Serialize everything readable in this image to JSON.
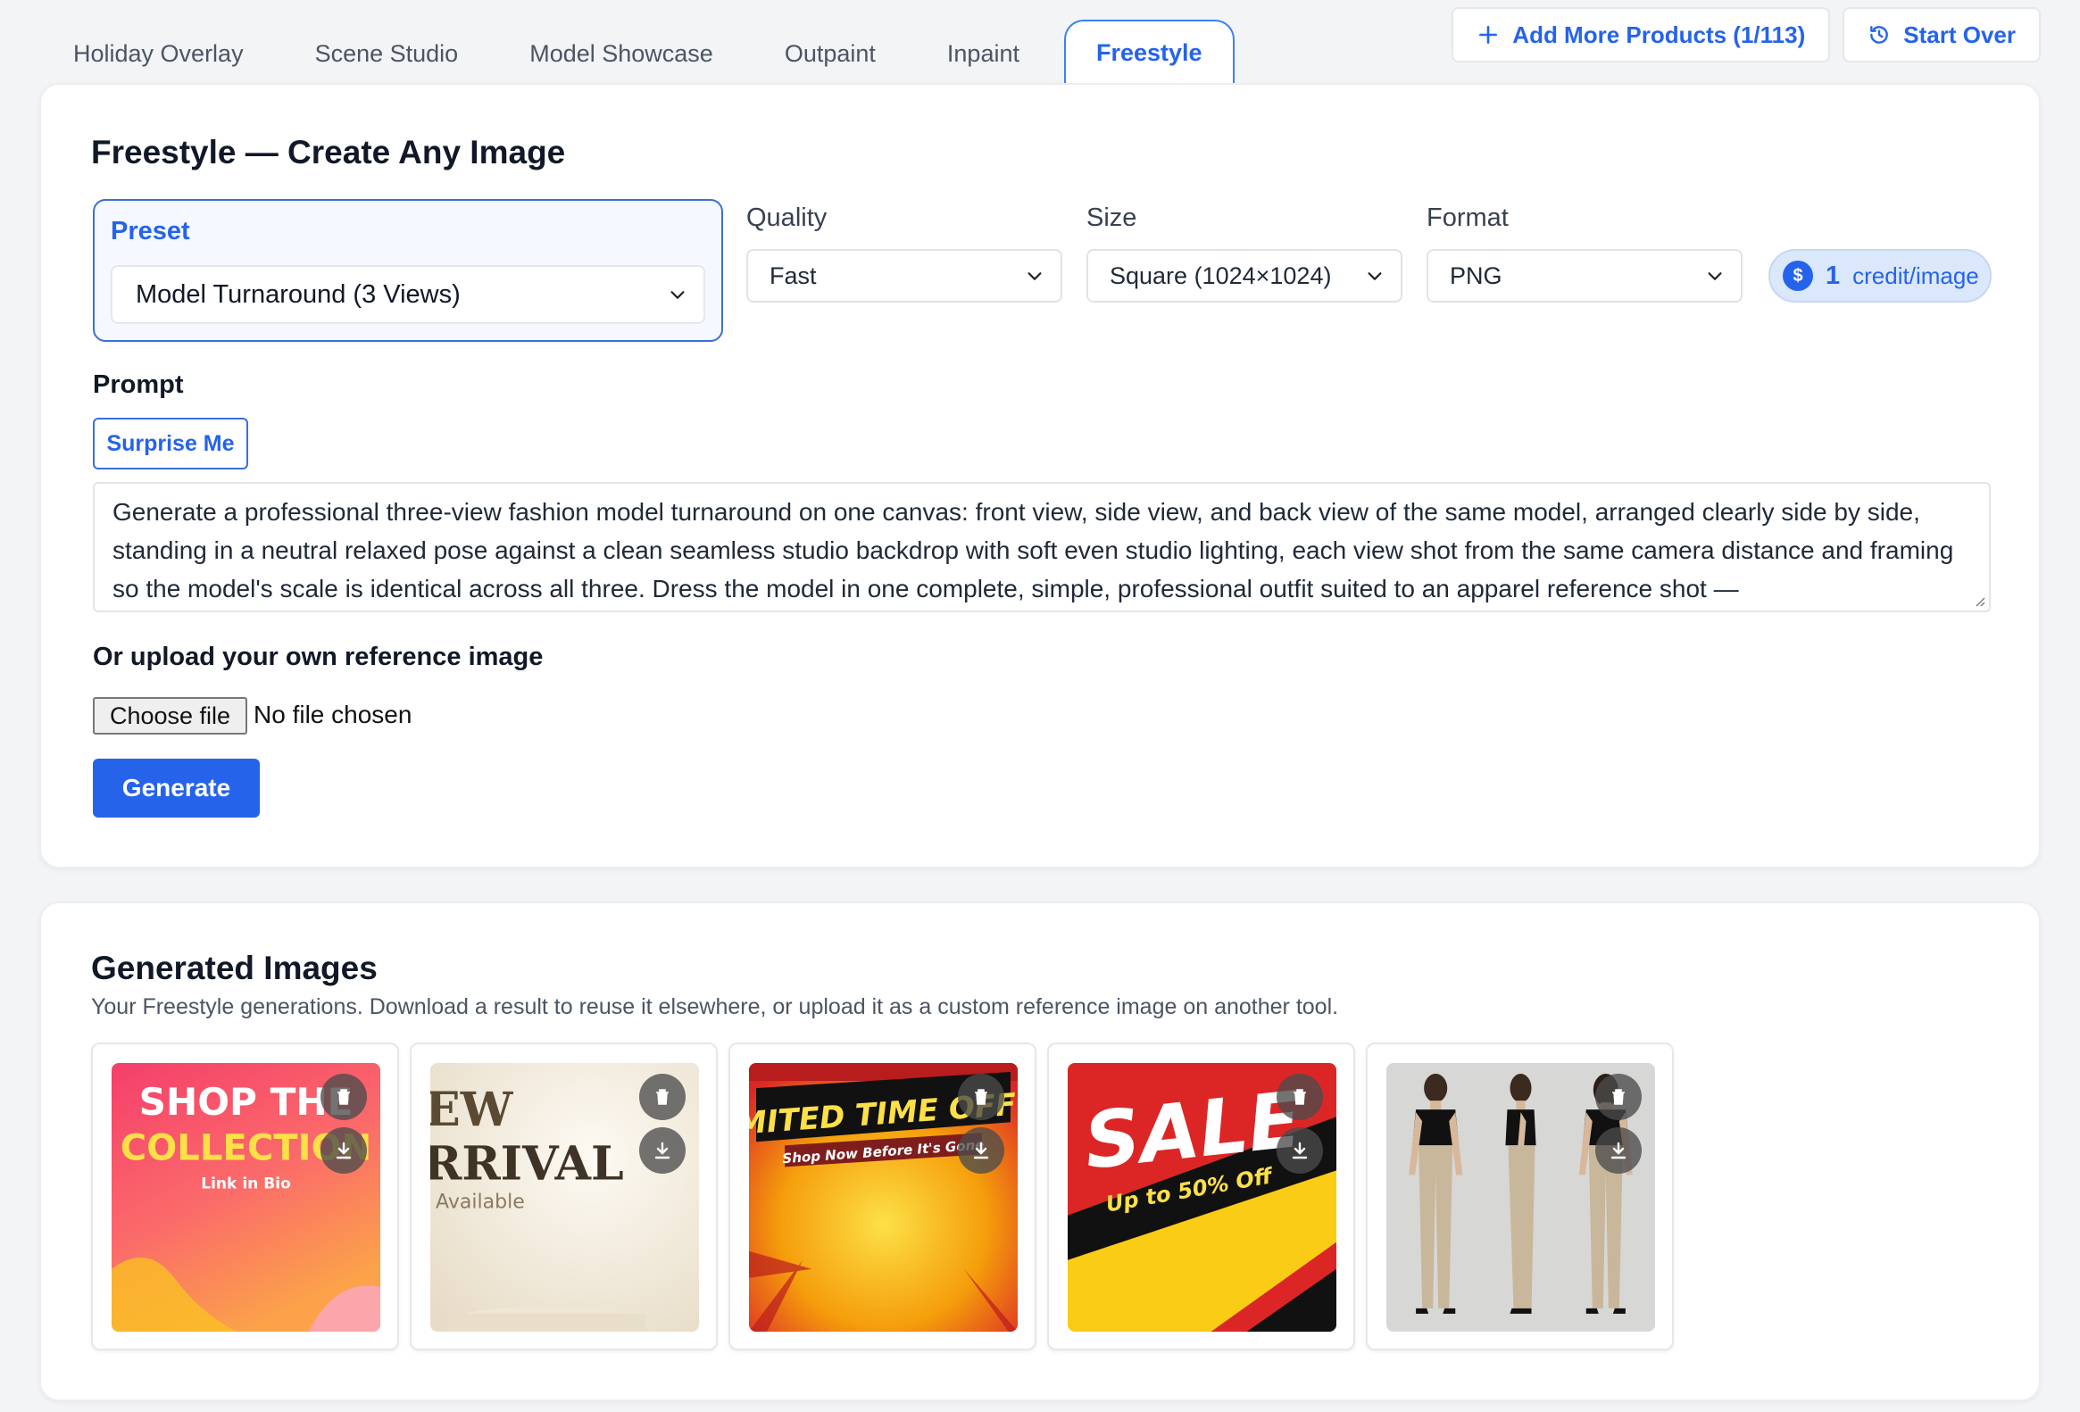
{
  "tabs": [
    {
      "label": "Holiday Overlay"
    },
    {
      "label": "Scene Studio"
    },
    {
      "label": "Model Showcase"
    },
    {
      "label": "Outpaint"
    },
    {
      "label": "Inpaint"
    },
    {
      "label": "Freestyle",
      "active": true
    }
  ],
  "actions": {
    "add_products": "Add More Products (1/113)",
    "start_over": "Start Over"
  },
  "form": {
    "title": "Freestyle — Create Any Image",
    "preset_label": "Preset",
    "preset_value": "Model Turnaround (3 Views)",
    "quality_label": "Quality",
    "quality_value": "Fast",
    "size_label": "Size",
    "size_value": "Square (1024×1024)",
    "format_label": "Format",
    "format_value": "PNG",
    "credit_count": "1",
    "credit_unit": "credit/image",
    "prompt_label": "Prompt",
    "surprise_label": "Surprise Me",
    "prompt_text": "Generate a professional three-view fashion model turnaround on one canvas: front view, side view, and back view of the same model, arranged clearly side by side, standing in a neutral relaxed pose against a clean seamless studio backdrop with soft even studio lighting, each view shot from the same camera distance and framing so the model's scale is identical across all three. Dress the model in one complete, simple, professional outfit suited to an apparel reference shot —",
    "upload_label": "Or upload your own reference image",
    "choose_file": "Choose file",
    "no_file": "No file chosen",
    "generate_label": "Generate"
  },
  "gallery": {
    "title": "Generated Images",
    "subtitle": "Your Freestyle generations. Download a result to reuse it elsewhere, or upload it as a custom reference image on another tool.",
    "images": [
      {
        "line1": "SHOP THE",
        "line2": "COLLECTION",
        "line3": "Link in Bio"
      },
      {
        "line1": "EW",
        "line2": "RRIVAL",
        "line3": "Available"
      },
      {
        "line1": "LIMITED TIME OFFER",
        "line2": "Shop Now Before It's Gone"
      },
      {
        "line1": "SALE",
        "line2": "Up to 50% Off"
      },
      {
        "line1": ""
      }
    ]
  },
  "colors": {
    "accent": "#2563eb",
    "border_active": "#3b82f6"
  }
}
